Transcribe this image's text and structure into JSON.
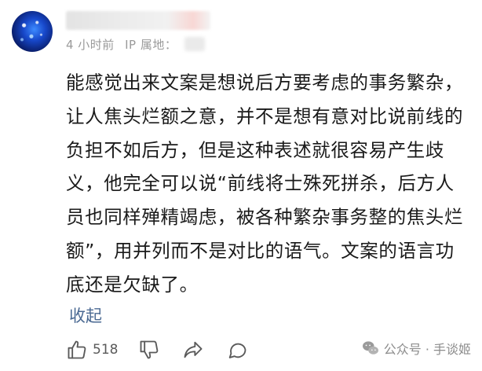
{
  "comment": {
    "meta": {
      "time": "4 小时前",
      "ip_label": "IP 属地："
    },
    "text": "能感觉出来文案是想说后方要考虑的事务繁杂，让人焦头烂额之意，并不是想有意对比说前线的负担不如后方，但是这种表述就很容易产生歧义，他完全可以说“前线将士殊死拼杀，后方人员也同样殚精竭虑，被各种繁杂事务整的焦头烂额”，用并列而不是对比的语气。文案的语言功底还是欠缺了。",
    "collapse_label": "收起",
    "likes": "518"
  },
  "icons": {
    "like": "thumbs-up-icon",
    "dislike": "thumbs-down-icon",
    "share": "share-icon",
    "comment": "comment-icon"
  },
  "watermark": {
    "text": "公众号 · 手谈姬"
  },
  "colors": {
    "link": "#4b6a93",
    "meta": "#9a9a9a",
    "text": "#1a1a1a"
  }
}
